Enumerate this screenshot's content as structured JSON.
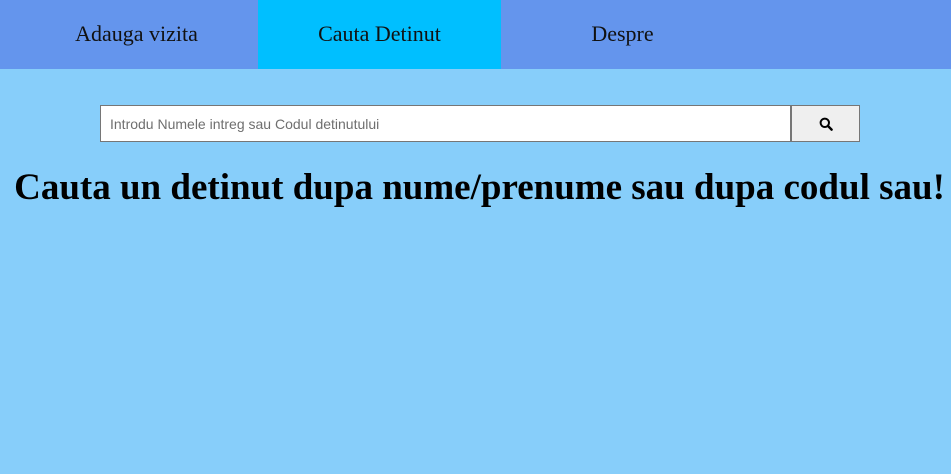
{
  "nav": {
    "items": [
      {
        "label": "Adauga vizita",
        "active": false
      },
      {
        "label": "Cauta Detinut",
        "active": true
      },
      {
        "label": "Despre",
        "active": false
      }
    ]
  },
  "search": {
    "placeholder": "Introdu Numele intreg sau Codul detinutului",
    "value": "",
    "button_icon": "search-icon"
  },
  "main": {
    "heading": "Cauta un detinut dupa nume/prenume sau dupa codul sau!"
  },
  "colors": {
    "page_background": "#87CEFA",
    "navbar_background": "#6495ED",
    "active_tab_background": "#00BFFF"
  }
}
